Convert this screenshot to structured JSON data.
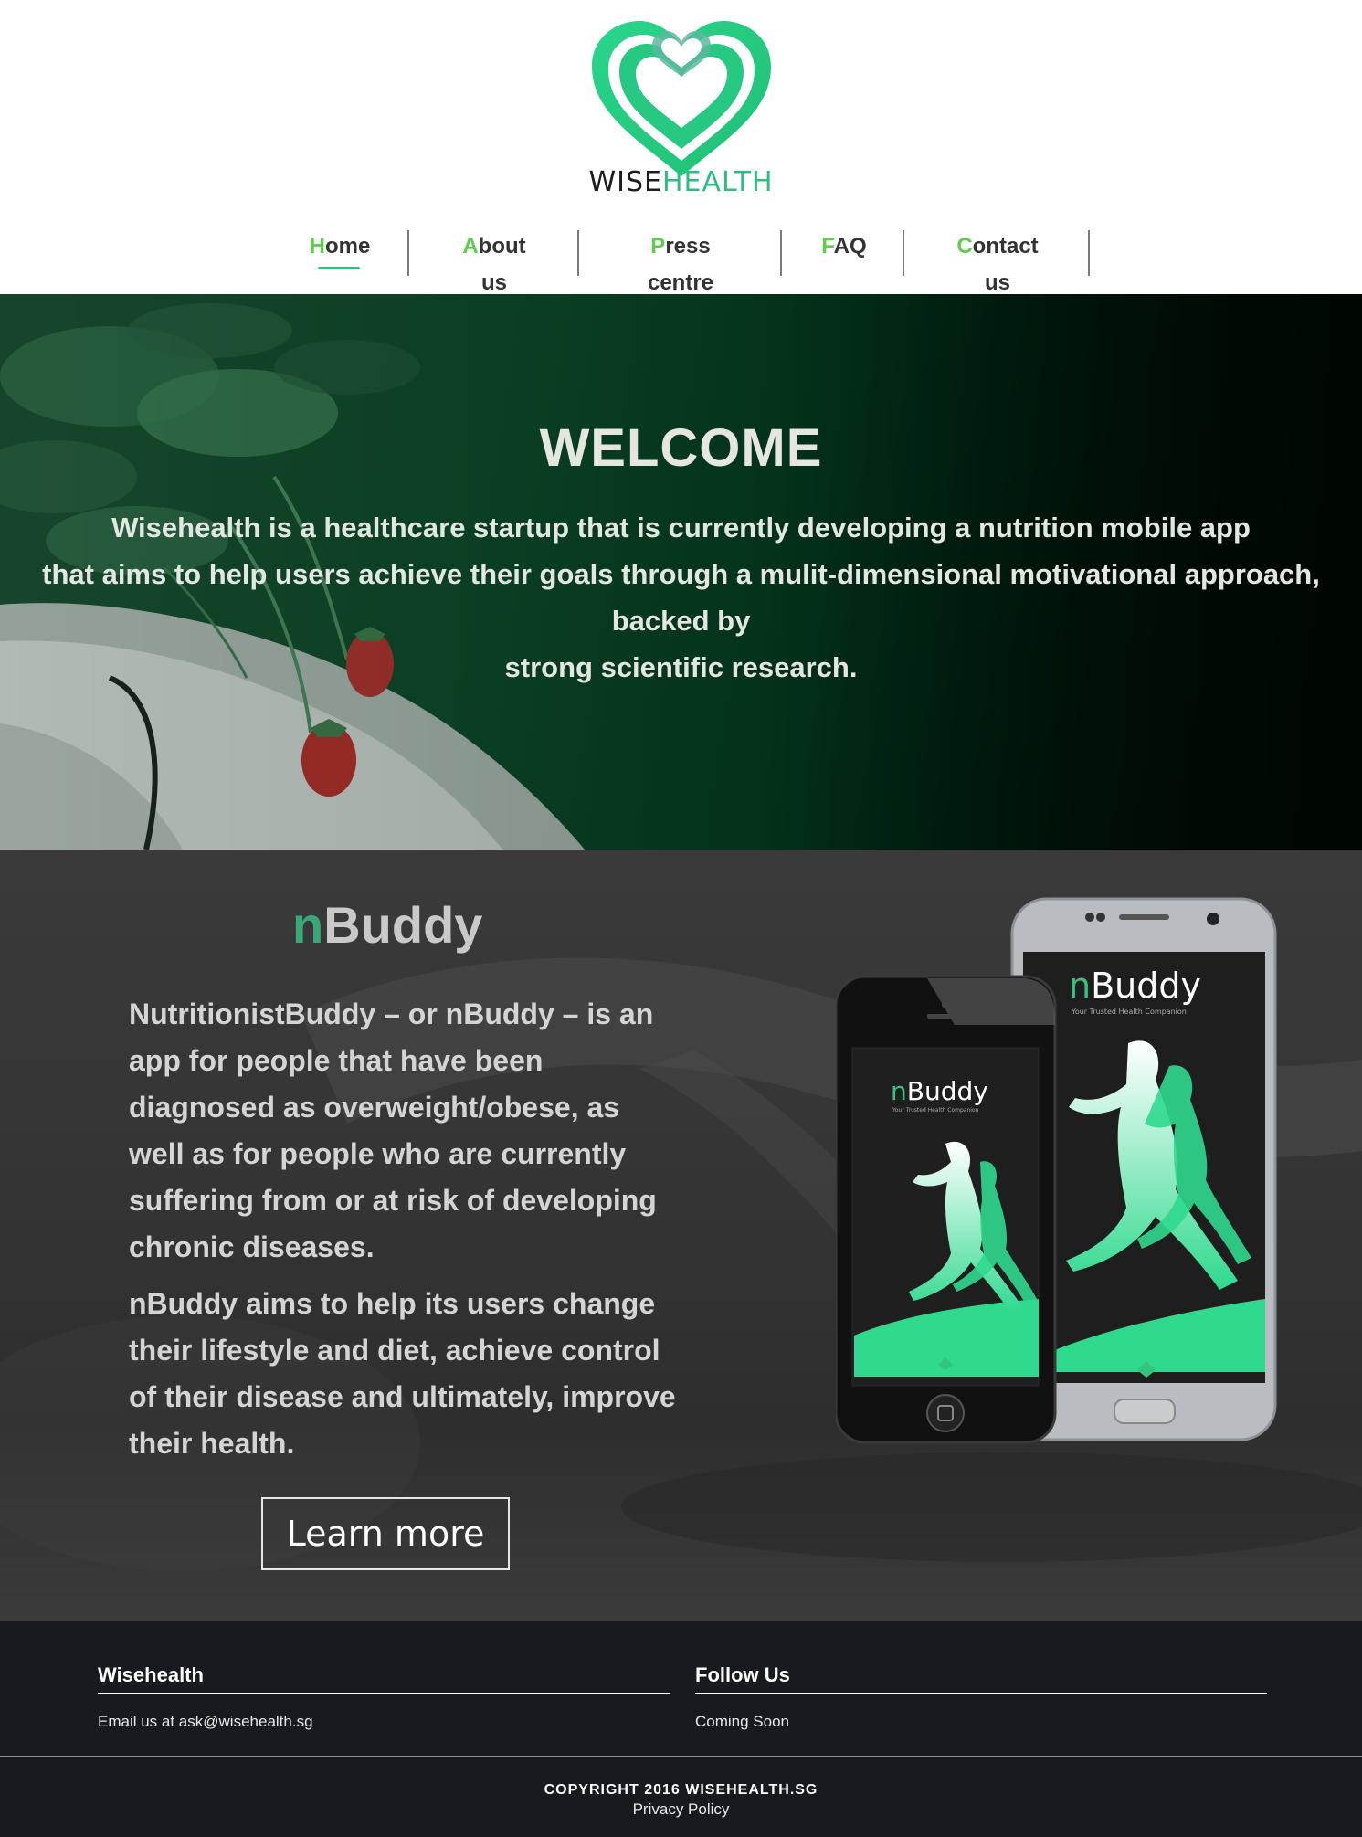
{
  "header": {
    "logo_word_1": "WISE",
    "logo_word_2": "HEALTH",
    "nav": [
      {
        "first": "H",
        "rest": "ome"
      },
      {
        "first": "A",
        "rest": "bout us"
      },
      {
        "first": "P",
        "rest": "ress centre"
      },
      {
        "first": "F",
        "rest": "AQ"
      },
      {
        "first": "C",
        "rest": "ontact us"
      }
    ],
    "active_nav": "Home"
  },
  "hero": {
    "title": "WELCOME",
    "line1": "Wisehealth is a healthcare startup that is currently developing a nutrition mobile app",
    "line2": "that aims to help users achieve their goals through a mulit-dimensional motivational approach,",
    "line3": "backed by",
    "line4": "strong scientific research."
  },
  "nbuddy": {
    "title_n": "n",
    "title_rest": "Buddy",
    "para1": "NutritionistBuddy – or nBuddy – is an app for people that have been diagnosed as overweight/obese, as well as for people who are currently suffering from or at risk of developing chronic diseases.",
    "para2": "nBuddy aims to help its users change their lifestyle and diet, achieve control of their disease and ultimately, improve their health.",
    "learn_more": "Learn more",
    "phone_app_n": "n",
    "phone_app_name": "Buddy",
    "phone_tagline": "Your Trusted Health Companion"
  },
  "footer": {
    "col1_head": "Wisehealth",
    "col1_text": "Email us at ask@wisehealth.sg",
    "col2_head": "Follow Us",
    "col2_text": "Coming Soon",
    "copyright": "COPYRIGHT 2016 WISEHEALTH.SG",
    "privacy": "Privacy Policy"
  },
  "colors": {
    "brand_green": "#2bbf7e",
    "nav_initial": "#5bcf49",
    "footer_bg": "#181a1f"
  }
}
